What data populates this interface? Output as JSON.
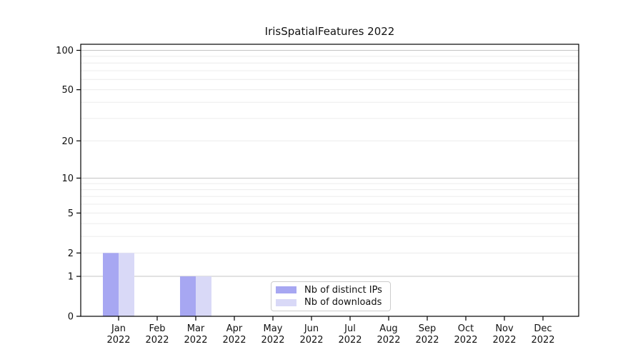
{
  "chart_data": {
    "type": "bar",
    "title": "IrisSpatialFeatures 2022",
    "categories": [
      "Jan",
      "Feb",
      "Mar",
      "Apr",
      "May",
      "Jun",
      "Jul",
      "Aug",
      "Sep",
      "Oct",
      "Nov",
      "Dec"
    ],
    "x_year": "2022",
    "series": [
      {
        "name": "Nb of distinct IPs",
        "color": "#a7a7f2",
        "values": [
          2,
          0,
          1,
          0,
          0,
          0,
          0,
          0,
          0,
          0,
          0,
          0
        ]
      },
      {
        "name": "Nb of downloads",
        "color": "#d9d9f7",
        "values": [
          2,
          0,
          1,
          0,
          0,
          0,
          0,
          0,
          0,
          0,
          0,
          0
        ]
      }
    ],
    "yticks": [
      0,
      1,
      2,
      5,
      10,
      20,
      50,
      100
    ],
    "yscale": "log1p",
    "ylim": [
      0,
      112
    ],
    "grid": "horizontal",
    "legend": {
      "position": "lower-center-inside"
    }
  }
}
